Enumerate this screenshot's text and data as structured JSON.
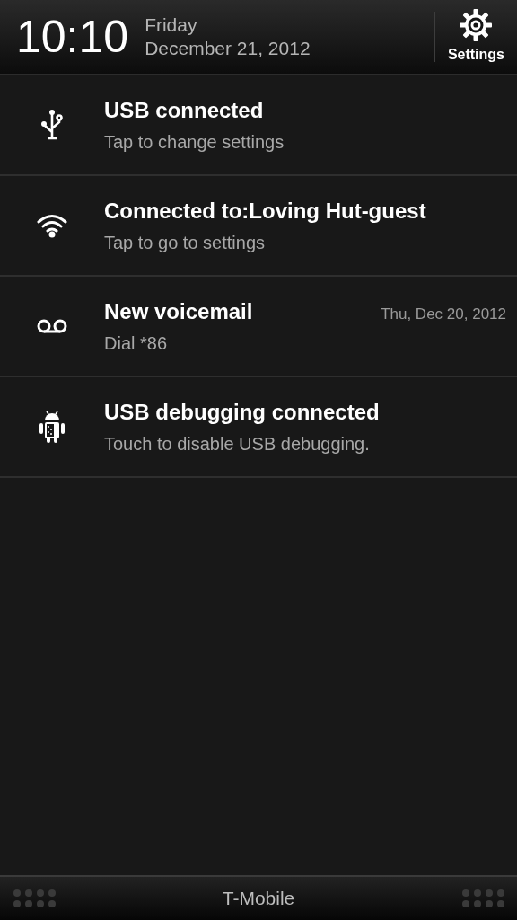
{
  "header": {
    "time": "10:10",
    "day": "Friday",
    "date": "December 21, 2012",
    "settings_label": "Settings"
  },
  "notifications": [
    {
      "kind": "usb",
      "title": "USB connected",
      "subtitle": "Tap to change settings"
    },
    {
      "kind": "wifi",
      "title": "Connected to:Loving Hut-guest",
      "subtitle": "Tap to go to settings"
    },
    {
      "kind": "voicemail",
      "title": "New voicemail",
      "subtitle": "Dial *86",
      "time": "Thu, Dec 20, 2012"
    },
    {
      "kind": "android",
      "title": "USB debugging connected",
      "subtitle": "Touch to disable USB debugging."
    }
  ],
  "footer": {
    "carrier": "T-Mobile"
  }
}
